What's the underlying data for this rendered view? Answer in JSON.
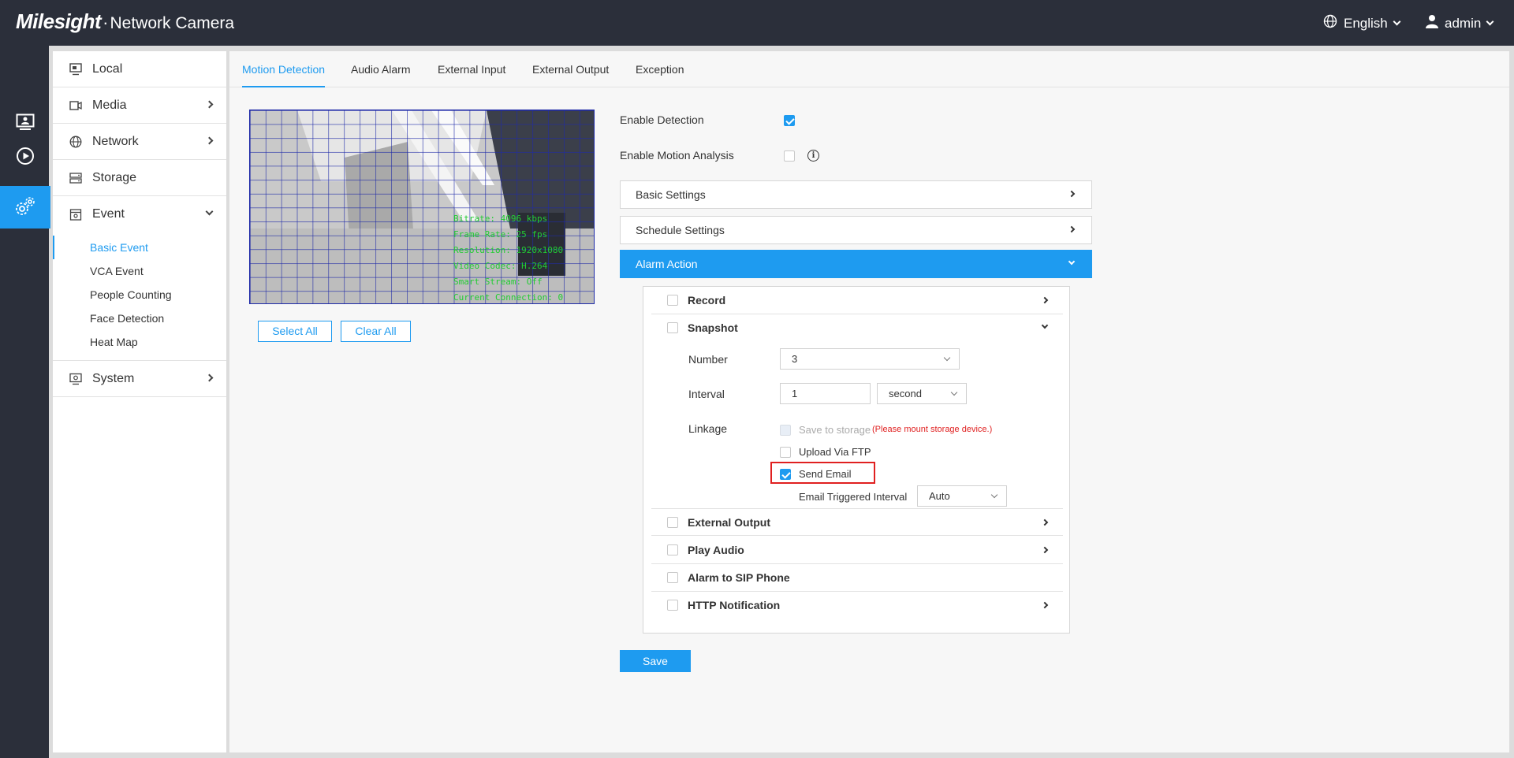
{
  "header": {
    "brand": "Milesight",
    "separator": "·",
    "product": "Network Camera",
    "language": "English",
    "user": "admin"
  },
  "rail": {
    "items": [
      "live-view-icon",
      "playback-icon",
      "settings-icon"
    ],
    "active": "settings-icon"
  },
  "menu": {
    "local": "Local",
    "media": "Media",
    "network": "Network",
    "storage": "Storage",
    "event": "Event",
    "system": "System",
    "event_sub": [
      "Basic Event",
      "VCA Event",
      "People Counting",
      "Face Detection",
      "Heat Map"
    ]
  },
  "tabs": [
    "Motion Detection",
    "Audio Alarm",
    "External Input",
    "External Output",
    "Exception"
  ],
  "video": {
    "overlay_lines": [
      "Bitrate: 4096 kbps",
      "Frame Rate: 25 fps",
      "Resolution: 1920x1080",
      "Video Codec: H.264",
      "Smart Stream: Off",
      "Current Connection: 0"
    ],
    "select_all": "Select All",
    "clear_all": "Clear All"
  },
  "detection": {
    "enable_label": "Enable Detection",
    "enable_checked": true,
    "motion_analysis_label": "Enable Motion Analysis",
    "motion_analysis_checked": false
  },
  "sections": {
    "basic": "Basic Settings",
    "schedule": "Schedule Settings",
    "alarm": "Alarm Action"
  },
  "alarm": {
    "record": "Record",
    "snapshot": "Snapshot",
    "number_label": "Number",
    "number_value": "3",
    "interval_label": "Interval",
    "interval_value": "1",
    "interval_unit": "second",
    "linkage_label": "Linkage",
    "save_storage": "Save to storage",
    "storage_warning": "(Please mount storage device.)",
    "upload_ftp": "Upload Via FTP",
    "send_email": "Send Email",
    "send_email_checked": true,
    "email_interval_label": "Email Triggered Interval",
    "email_interval_value": "Auto",
    "external_output": "External Output",
    "play_audio": "Play Audio",
    "sip_phone": "Alarm to SIP Phone",
    "http_notification": "HTTP Notification"
  },
  "save": "Save",
  "colors": {
    "accent": "#1e9bf0",
    "header_bg": "#2b2f3a",
    "warning": "#e02020",
    "grid": "#1f2aa8",
    "overlay_text": "#22cc33"
  }
}
